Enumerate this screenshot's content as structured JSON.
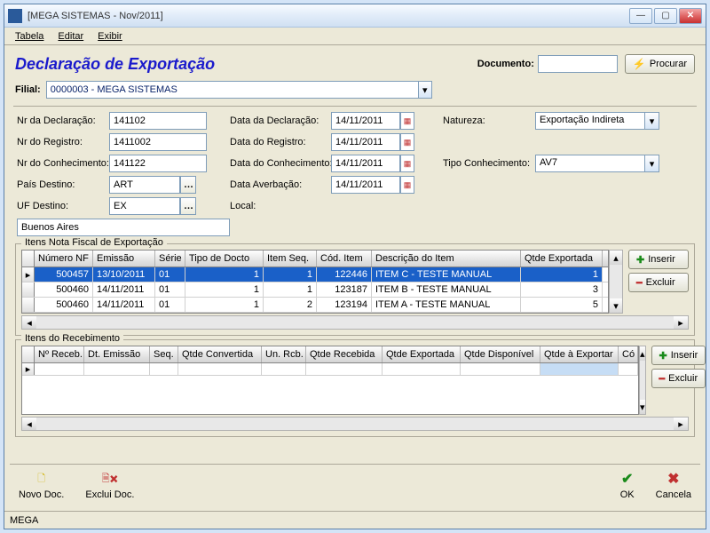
{
  "window": {
    "title": "[MEGA SISTEMAS - Nov/2011]",
    "menu": {
      "tabela": "Tabela",
      "editar": "Editar",
      "exibir": "Exibir"
    }
  },
  "header": {
    "title": "Declaração de Exportação",
    "documento_label": "Documento:",
    "procurar": "Procurar"
  },
  "filial": {
    "label": "Filial:",
    "value": "0000003 - MEGA SISTEMAS"
  },
  "form": {
    "nr_decl_label": "Nr da Declaração:",
    "nr_decl": "141102",
    "nr_reg_label": "Nr do Registro:",
    "nr_reg": "1411002",
    "nr_con_label": "Nr do Conhecimento:",
    "nr_con": "141122",
    "pais_label": "País Destino:",
    "pais": "ART",
    "uf_label": "UF Destino:",
    "uf": "EX",
    "data_decl_label": "Data da Declaração:",
    "data_decl": "14/11/2011",
    "data_reg_label": "Data do Registro:",
    "data_reg": "14/11/2011",
    "data_con_label": "Data do Conhecimento:",
    "data_con": "14/11/2011",
    "data_averb_label": "Data Averbação:",
    "data_averb": "14/11/2011",
    "local_label": "Local:",
    "local": "Buenos Aires",
    "natureza_label": "Natureza:",
    "natureza": "Exportação Indireta",
    "tipo_con_label": "Tipo Conhecimento:",
    "tipo_con": "AV7"
  },
  "grid1": {
    "title": "Itens Nota Fiscal de Exportação",
    "cols": {
      "nf": "Número NF",
      "em": "Emissão",
      "se": "Série",
      "td": "Tipo de Docto",
      "is": "Item Seq.",
      "ci": "Cód. Item",
      "de": "Descrição do Item",
      "qe": "Qtde Exportada"
    },
    "rows": [
      {
        "nf": "500457",
        "em": "13/10/2011",
        "se": "01",
        "td": "1",
        "is": "1",
        "ci": "122446",
        "de": "ITEM C - TESTE MANUAL",
        "qe": "1"
      },
      {
        "nf": "500460",
        "em": "14/11/2011",
        "se": "01",
        "td": "1",
        "is": "1",
        "ci": "123187",
        "de": "ITEM B - TESTE MANUAL",
        "qe": "3"
      },
      {
        "nf": "500460",
        "em": "14/11/2011",
        "se": "01",
        "td": "1",
        "is": "2",
        "ci": "123194",
        "de": "ITEM A - TESTE MANUAL",
        "qe": "5"
      }
    ]
  },
  "grid2": {
    "title": "Itens do Recebimento",
    "cols": {
      "nr": "Nº Receb.",
      "de": "Dt. Emissão",
      "sq": "Seq.",
      "qc": "Qtde Convertida",
      "ur": "Un. Rcb.",
      "qr": "Qtde Recebida",
      "qe": "Qtde Exportada",
      "qd": "Qtde Disponível",
      "qx": "Qtde à Exportar",
      "co": "Có"
    }
  },
  "buttons": {
    "inserir": "Inserir",
    "excluir": "Excluir"
  },
  "footer": {
    "novo": "Novo Doc.",
    "exclui": "Exclui Doc.",
    "ok": "OK",
    "cancela": "Cancela"
  },
  "status": {
    "text": "MEGA"
  }
}
